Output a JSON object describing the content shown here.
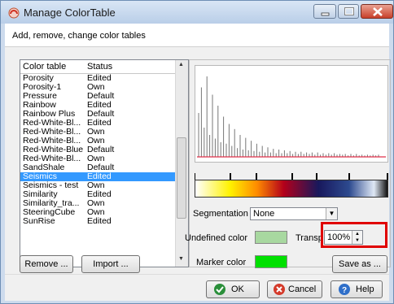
{
  "window": {
    "title": "Manage ColorTable"
  },
  "header": {
    "subtitle": "Add, remove, change color tables"
  },
  "list": {
    "columns": [
      "Color table",
      "Status"
    ],
    "rows": [
      {
        "name": "Porosity",
        "status": "Edited"
      },
      {
        "name": "Porosity-1",
        "status": "Own"
      },
      {
        "name": "Pressure",
        "status": "Default"
      },
      {
        "name": "Rainbow",
        "status": "Edited"
      },
      {
        "name": "Rainbow Plus",
        "status": "Default"
      },
      {
        "name": "Red-White-Bl...",
        "status": "Edited"
      },
      {
        "name": "Red-White-Bl...",
        "status": "Own"
      },
      {
        "name": "Red-White-Bl...",
        "status": "Own"
      },
      {
        "name": "Red-White-Blue",
        "status": "Default"
      },
      {
        "name": "Red-White-Bl...",
        "status": "Own"
      },
      {
        "name": "SandShale",
        "status": "Default"
      },
      {
        "name": "Seismics",
        "status": "Edited"
      },
      {
        "name": "Seismics - test",
        "status": "Own"
      },
      {
        "name": "Similarity",
        "status": "Edited"
      },
      {
        "name": "Similarity_tra...",
        "status": "Own"
      },
      {
        "name": "SteeringCube",
        "status": "Own"
      },
      {
        "name": "SunRise",
        "status": "Edited"
      }
    ],
    "selected_index": 11
  },
  "segmentation": {
    "label": "Segmentation",
    "value": "None"
  },
  "undefined_color": {
    "label": "Undefined color",
    "color": "#a8d8a0"
  },
  "transparency": {
    "label": "Transp",
    "value": "100%"
  },
  "marker_color": {
    "label": "Marker color",
    "color": "#00e000"
  },
  "buttons": {
    "remove": "Remove ...",
    "import": "Import ...",
    "save_as": "Save as ...",
    "ok": "OK",
    "cancel": "Cancel",
    "help": "Help"
  },
  "colors": {
    "selection": "#3399ff",
    "highlight_box": "#e00000",
    "histogram_baseline": "#e0304a"
  },
  "icons": {
    "app": "colortable-app-icon",
    "minimize": "minimize-icon",
    "maximize": "maximize-icon",
    "close": "close-icon",
    "ok": "ok-check-icon",
    "cancel": "cancel-x-icon",
    "help": "help-question-icon"
  }
}
